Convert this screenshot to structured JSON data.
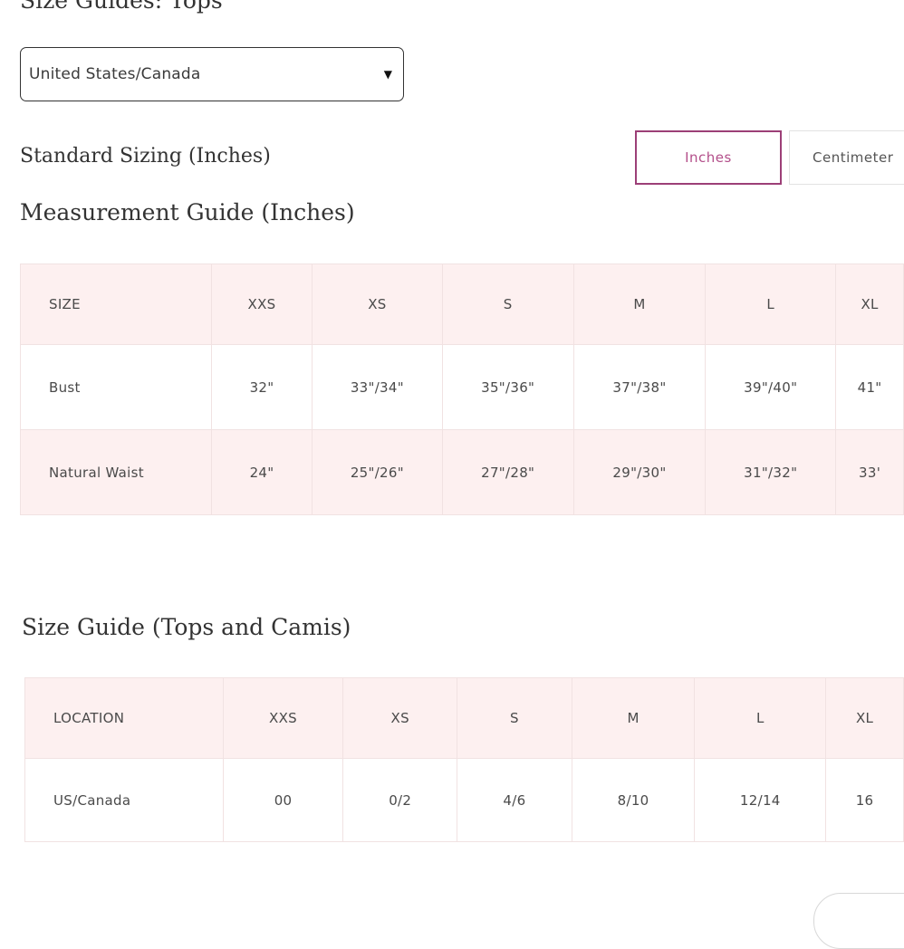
{
  "page": {
    "title": "Size Guides: Tops"
  },
  "region_select": {
    "value": "United States/Canada",
    "caret": "▼"
  },
  "units": {
    "heading": "Standard Sizing (Inches)",
    "inches_label": "Inches",
    "centimeters_label": "Centimeter",
    "selected": "Inches",
    "accent_color": "#9c3f77"
  },
  "measurement_guide": {
    "title": "Measurement Guide (Inches)",
    "header": [
      "SIZE",
      "XXS",
      "XS",
      "S",
      "M",
      "L",
      "XL"
    ],
    "rows": [
      [
        "Bust",
        "32\"",
        "33\"/34\"",
        "35\"/36\"",
        "37\"/38\"",
        "39\"/40\"",
        "41\""
      ],
      [
        "Natural Waist",
        "24\"",
        "25\"/26\"",
        "27\"/28\"",
        "29\"/30\"",
        "31\"/32\"",
        "33'"
      ]
    ]
  },
  "size_guide": {
    "title": "Size Guide (Tops and Camis)",
    "header": [
      "LOCATION",
      "XXS",
      "XS",
      "S",
      "M",
      "L",
      "XL"
    ],
    "rows": [
      [
        "US/Canada",
        "00",
        "0/2",
        "4/6",
        "8/10",
        "12/14",
        "16"
      ]
    ]
  },
  "colors": {
    "header_row_bg": "#fdf0f0",
    "border": "#f1e2e2"
  }
}
